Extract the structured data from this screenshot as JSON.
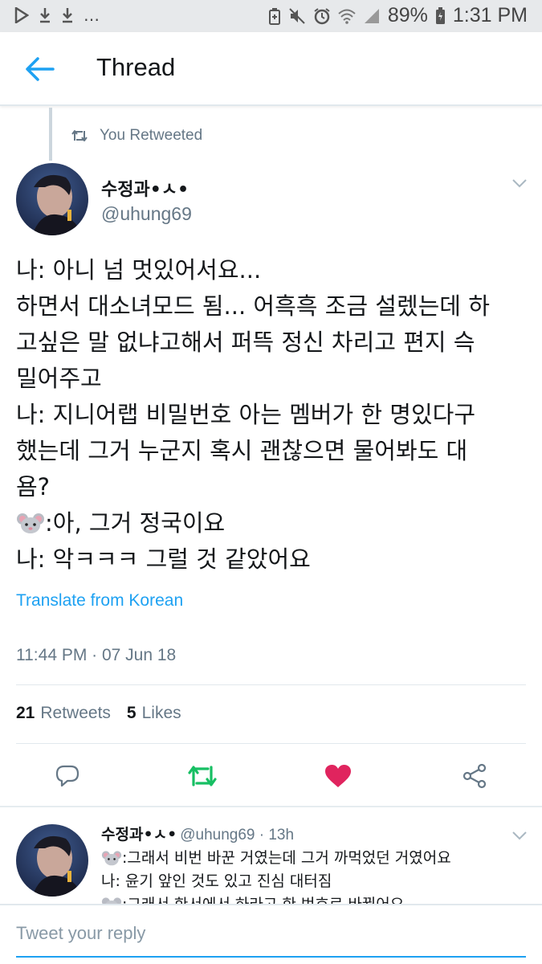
{
  "status_bar": {
    "battery_percent": "89%",
    "time": "1:31 PM",
    "left_icons": [
      "play-store-icon",
      "download-icon",
      "download-icon",
      "ellipsis"
    ],
    "right_icons": [
      "battery-saver-icon",
      "mute-icon",
      "alarm-icon",
      "wifi-icon",
      "signal-icon",
      "battery-icon"
    ]
  },
  "app_bar": {
    "title": "Thread"
  },
  "retweet_note": "You Retweeted",
  "tweet": {
    "author_name": "수정과•ㅅ•",
    "author_handle": "@uhung69",
    "lines": [
      "나: 아니 넘 멋있어서요...",
      "하면서 대소녀모드 됨... 어흑흑 조금 설렜는데 하",
      "고싶은 말 없냐고해서 퍼뜩 정신 차리고 편지 슥",
      "밀어주고",
      "나: 지니어랩 비밀번호 아는 멤버가 한 명있다구",
      "했는데 그거 누군지 혹시 괜찮으면 물어봐도 대",
      "욤?",
      ":아, 그거 정국이요",
      "나: 악ㅋㅋㅋ 그럴 것 같았어요"
    ],
    "translate_label": "Translate from Korean",
    "timestamp": "11:44 PM · 07 Jun 18",
    "retweets_count": "21",
    "retweets_label": "Retweets",
    "likes_count": "5",
    "likes_label": "Likes"
  },
  "reply": {
    "author_name": "수정과•ㅅ•",
    "meta": "@uhung69 · 13h",
    "lines": [
      ":그래서 비번 바꾼 거였는데 그거 까먹었던 거였어요",
      "나: 윤기 앞인 것도 있고 진심 대터짐",
      ":그래서 한서에서 하라고 한 번호로 바꿨어요"
    ]
  },
  "compose": {
    "placeholder": "Tweet your reply"
  },
  "colors": {
    "accent": "#1da1f2",
    "retweet_active": "#17bf63",
    "like_active": "#e0245e",
    "secondary_text": "#657786"
  }
}
